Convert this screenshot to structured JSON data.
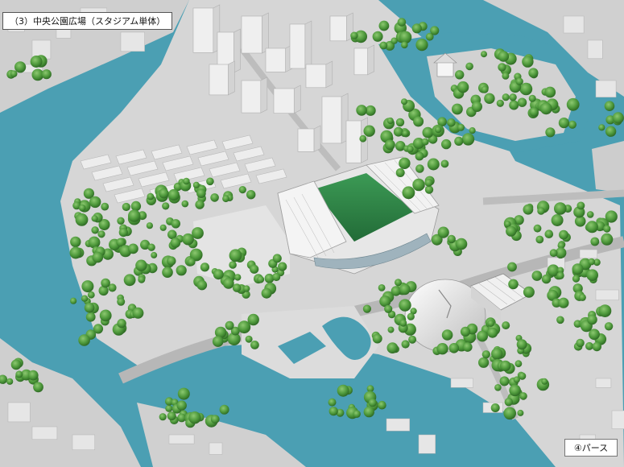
{
  "title": "（3）中央公園広場（スタジアム単体）",
  "caption": "④パース",
  "colors": {
    "water": "#4b9fb3",
    "land": "#d6d6d6",
    "road": "#bcbcbc",
    "tree": "#4f9a3c",
    "pitch": "#2f8a48",
    "building": "#ececec"
  }
}
